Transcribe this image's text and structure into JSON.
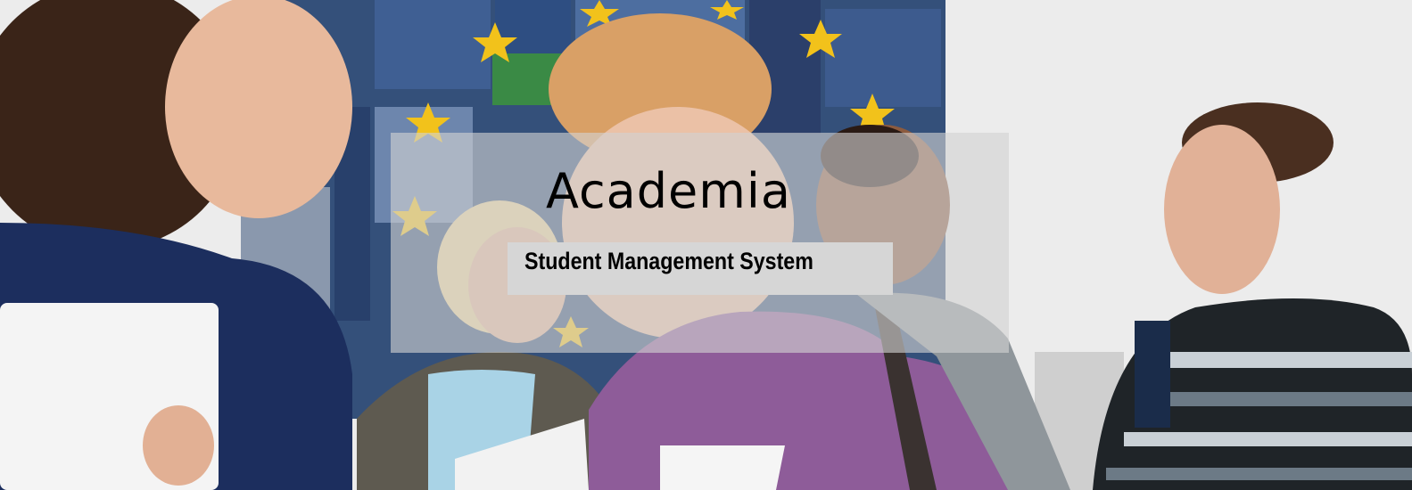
{
  "banner": {
    "title": "Academia",
    "subtitle": "Student Management System"
  },
  "photo": {
    "description_icon": "students-photo",
    "building_color": "#2f4f7a",
    "star_color": "#f2c21b",
    "sky_color": "#ececec"
  }
}
